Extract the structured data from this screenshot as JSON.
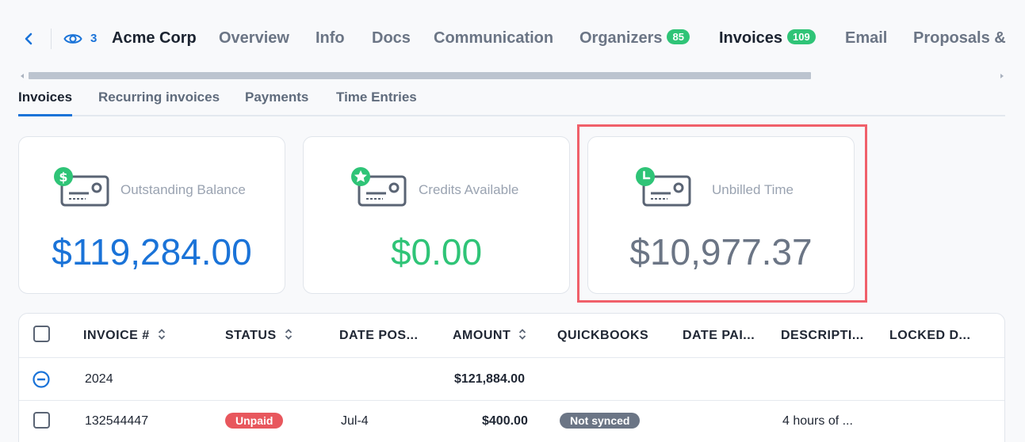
{
  "nav": {
    "view_count": "3",
    "client_name": "Acme Corp",
    "tabs": [
      {
        "label": "Overview"
      },
      {
        "label": "Info"
      },
      {
        "label": "Docs"
      },
      {
        "label": "Communication"
      },
      {
        "label": "Organizers",
        "badge": "85"
      },
      {
        "label": "Invoices",
        "badge": "109",
        "active": true
      },
      {
        "label": "Email"
      },
      {
        "label": "Proposals &"
      }
    ]
  },
  "subtabs": [
    "Invoices",
    "Recurring invoices",
    "Payments",
    "Time Entries"
  ],
  "cards": [
    {
      "label": "Outstanding Balance",
      "value": "$119,284.00",
      "icon": "dollar-icon",
      "color": "#1a73d8"
    },
    {
      "label": "Credits Available",
      "value": "$0.00",
      "icon": "star-icon",
      "color": "#2fc477"
    },
    {
      "label": "Unbilled Time",
      "value": "$10,977.37",
      "icon": "clock-icon",
      "color": "#6b7585"
    }
  ],
  "table": {
    "headers": [
      "INVOICE #",
      "STATUS",
      "DATE POS...",
      "AMOUNT",
      "QUICKBOOKS",
      "DATE PAI...",
      "DESCRIPTI...",
      "LOCKED D..."
    ],
    "group": {
      "year": "2024",
      "amount": "$121,884.00"
    },
    "rows": [
      {
        "invoice": "132544447",
        "status": "Unpaid",
        "date_posted": "Jul-4",
        "amount": "$400.00",
        "quickbooks": "Not synced",
        "description": "4 hours of ..."
      }
    ]
  },
  "colors": {
    "accent": "#1a73d8",
    "green": "#2fc477",
    "unpaid": "#e8575d",
    "not_synced": "#6b7585",
    "highlight": "#f0606a"
  }
}
